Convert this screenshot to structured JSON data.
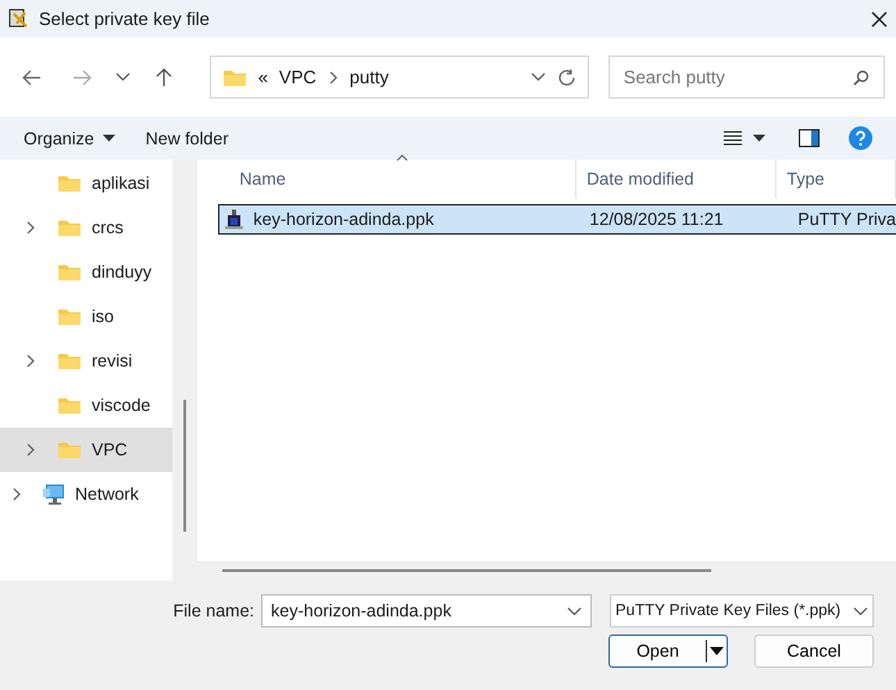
{
  "window": {
    "title": "Select private key file"
  },
  "address": {
    "crumbs": [
      "VPC",
      "putty"
    ],
    "overflow": "«"
  },
  "search": {
    "placeholder": "Search putty"
  },
  "toolbar": {
    "organize": "Organize",
    "new_folder": "New folder"
  },
  "sidebar": {
    "items": [
      {
        "label": "aplikasi",
        "kind": "folder",
        "expandable": false,
        "selected": false
      },
      {
        "label": "crcs",
        "kind": "folder",
        "expandable": true,
        "selected": false
      },
      {
        "label": "dinduyy",
        "kind": "folder",
        "expandable": false,
        "selected": false
      },
      {
        "label": "iso",
        "kind": "folder",
        "expandable": false,
        "selected": false
      },
      {
        "label": "revisi",
        "kind": "folder",
        "expandable": true,
        "selected": false
      },
      {
        "label": "viscode",
        "kind": "folder",
        "expandable": false,
        "selected": false
      },
      {
        "label": "VPC",
        "kind": "folder",
        "expandable": true,
        "selected": true
      },
      {
        "label": "Network",
        "kind": "network",
        "expandable": true,
        "selected": false
      }
    ]
  },
  "table": {
    "columns": [
      "Name",
      "Date modified",
      "Type"
    ],
    "rows": [
      {
        "name": "key-horizon-adinda.ppk",
        "date": "12/08/2025 11:21",
        "type": "PuTTY Priva",
        "selected": true
      }
    ]
  },
  "footer": {
    "file_name_label": "File name:",
    "file_name": "key-horizon-adinda.ppk",
    "file_type": "PuTTY Private Key Files (*.ppk)",
    "open": "Open",
    "cancel": "Cancel"
  }
}
